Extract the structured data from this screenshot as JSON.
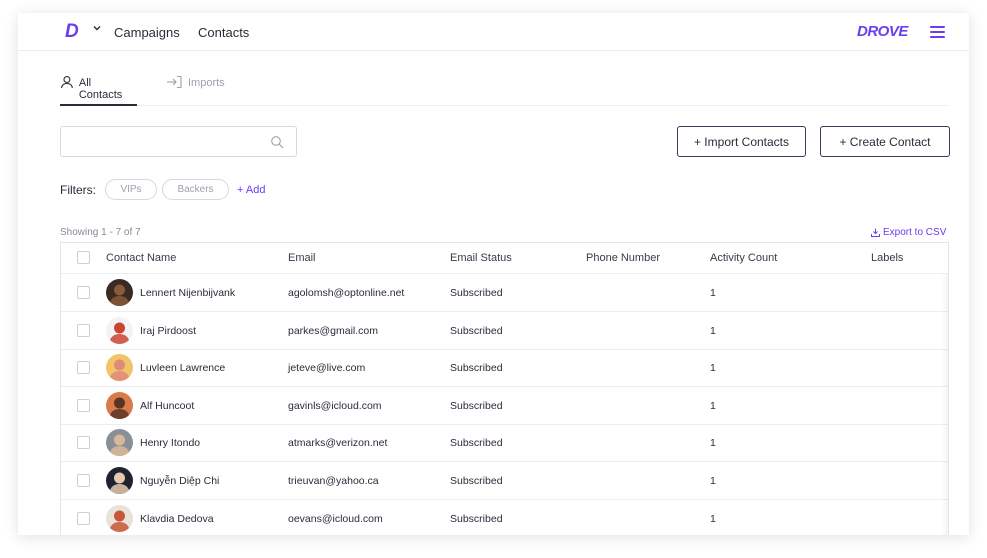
{
  "topnav": {
    "logo_letter": "D",
    "links": [
      "Campaigns",
      "Contacts"
    ],
    "brand": "DROVE",
    "accent": "#6a3df0"
  },
  "tabs": [
    {
      "label": "All Contacts",
      "icon": "person-icon",
      "active": true
    },
    {
      "label": "Imports",
      "icon": "import-icon",
      "active": false
    }
  ],
  "search": {
    "placeholder": "",
    "value": ""
  },
  "actions": {
    "import": "+ Import Contacts",
    "create": "+ Create Contact"
  },
  "filters": {
    "label": "Filters:",
    "chips": [
      "VIPs",
      "Backers"
    ],
    "add": "+ Add"
  },
  "showing": "Showing 1 - 7 of 7",
  "export": "Export to CSV",
  "table": {
    "columns": [
      "Contact Name",
      "Email",
      "Email Status",
      "Phone Number",
      "Activity Count",
      "Labels"
    ],
    "rows": [
      {
        "name": "Lennert Nijenbijvank",
        "email": "agolomsh@optonline.net",
        "status": "Subscribed",
        "phone": "",
        "activity": "1",
        "labels": "",
        "avatar_bg": "#3a2a22",
        "avatar_skin": "#8a5a3a"
      },
      {
        "name": "Iraj Pirdoost",
        "email": "parkes@gmail.com",
        "status": "Subscribed",
        "phone": "",
        "activity": "1",
        "labels": "",
        "avatar_bg": "#f3f3f3",
        "avatar_skin": "#c9452f"
      },
      {
        "name": "Luvleen Lawrence",
        "email": "jeteve@live.com",
        "status": "Subscribed",
        "phone": "",
        "activity": "1",
        "labels": "",
        "avatar_bg": "#f2c46a",
        "avatar_skin": "#e08a7a"
      },
      {
        "name": "Alf Huncoot",
        "email": "gavinls@icloud.com",
        "status": "Subscribed",
        "phone": "",
        "activity": "1",
        "labels": "",
        "avatar_bg": "#d87a4a",
        "avatar_skin": "#5a3422"
      },
      {
        "name": "Henry Itondo",
        "email": "atmarks@verizon.net",
        "status": "Subscribed",
        "phone": "",
        "activity": "1",
        "labels": "",
        "avatar_bg": "#8a8f96",
        "avatar_skin": "#d9b89a"
      },
      {
        "name": "Nguyễn Diệp Chi",
        "email": "trieuvan@yahoo.ca",
        "status": "Subscribed",
        "phone": "",
        "activity": "1",
        "labels": "",
        "avatar_bg": "#1e2330",
        "avatar_skin": "#e8c8b0"
      },
      {
        "name": "Klavdia Dedova",
        "email": "oevans@icloud.com",
        "status": "Subscribed",
        "phone": "",
        "activity": "1",
        "labels": "",
        "avatar_bg": "#e9e2d8",
        "avatar_skin": "#c8553a"
      }
    ]
  }
}
